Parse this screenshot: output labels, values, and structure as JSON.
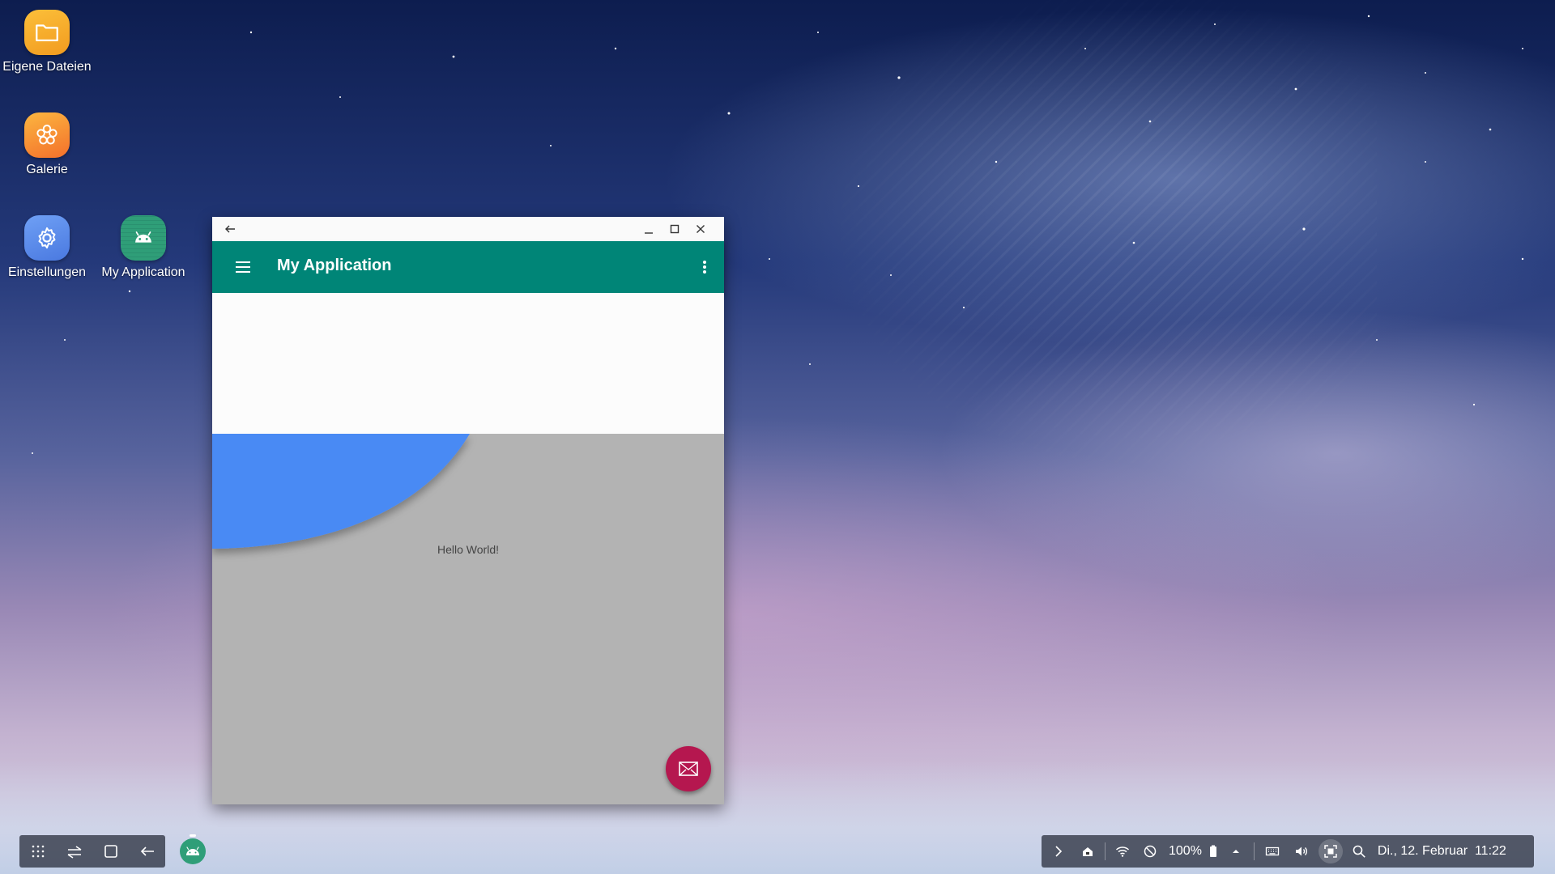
{
  "desktop": {
    "icons": [
      {
        "label": "Eigene Dateien",
        "icon": "folder-icon",
        "color": "#f5a623"
      },
      {
        "label": "Galerie",
        "icon": "flower-icon",
        "color": "#f58d2a"
      },
      {
        "label": "Einstellungen",
        "icon": "gear-icon",
        "color": "#5a8dee"
      },
      {
        "label": "My Application",
        "icon": "android-icon",
        "color": "#2f9e78"
      }
    ]
  },
  "window": {
    "titlebar": {
      "back_icon": "arrow-left-icon",
      "minimize_icon": "minimize-icon",
      "maximize_icon": "maximize-icon",
      "close_icon": "close-icon"
    },
    "appbar": {
      "title": "My Application",
      "color": "#008577",
      "menu_icon": "hamburger-icon",
      "more_icon": "more-vert-icon"
    },
    "content": {
      "text": "Hello World!",
      "shape_color": "#4a8af4"
    },
    "fab": {
      "icon": "mail-icon",
      "color": "#b5174f"
    }
  },
  "taskbar": {
    "nav_buttons": [
      "apps-grid-icon",
      "recent-apps-icon",
      "home-icon",
      "back-icon"
    ],
    "running_app_icon": "android-icon",
    "tray": {
      "battery": "100%",
      "datetime": "Di., 12. Februar  11:22",
      "icons": [
        "chevron-right-icon",
        "home-lock-icon",
        "wifi-icon",
        "do-not-disturb-icon",
        "battery-icon",
        "caret-up-icon",
        "keyboard-icon",
        "volume-icon",
        "screenshot-icon",
        "search-icon"
      ]
    }
  }
}
